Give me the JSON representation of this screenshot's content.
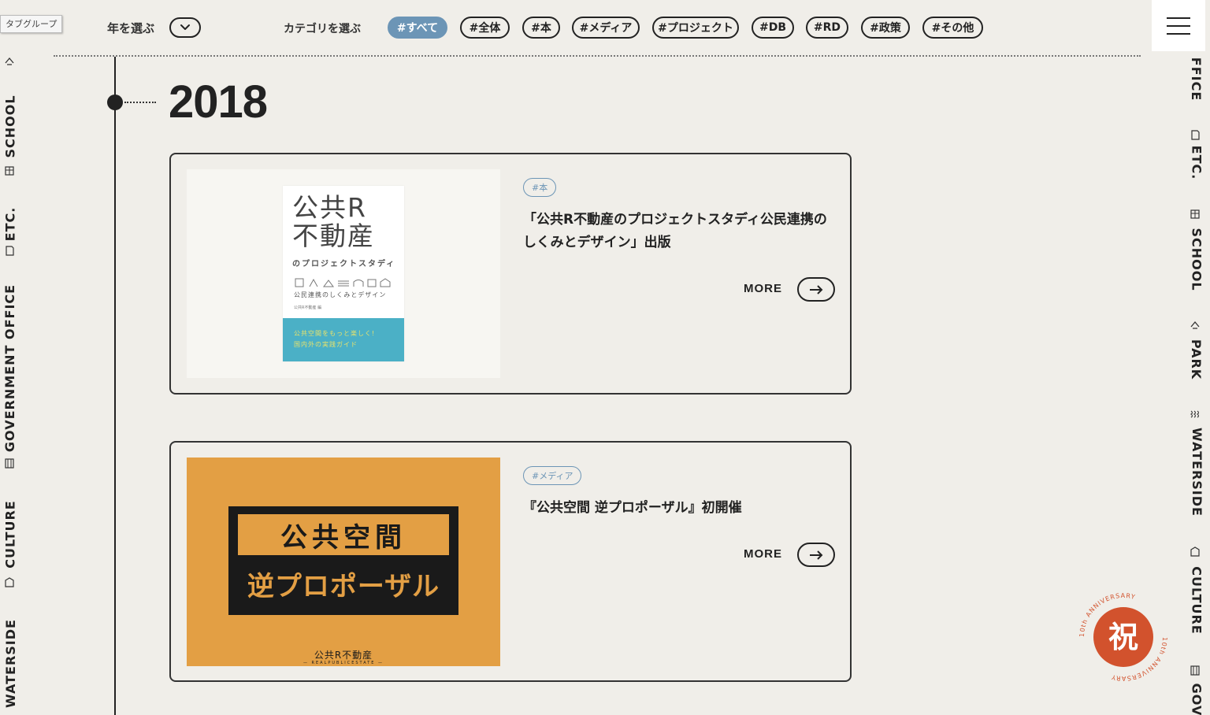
{
  "header": {
    "tag_group_label": "タブグループ",
    "year_select_label": "年を選ぶ",
    "category_select_label": "カテゴリを選ぶ",
    "categories": [
      {
        "label": "#すべて",
        "active": true
      },
      {
        "label": "#全体",
        "active": false
      },
      {
        "label": "#本",
        "active": false
      },
      {
        "label": "#メディア",
        "active": false
      },
      {
        "label": "#プロジェクト",
        "active": false
      },
      {
        "label": "#DB",
        "active": false
      },
      {
        "label": "#RD",
        "active": false
      },
      {
        "label": "#政策",
        "active": false
      },
      {
        "label": "#その他",
        "active": false
      }
    ],
    "menu_icon": "hamburger-icon"
  },
  "left_rail": {
    "labels": [
      "SCHOOL",
      "ETC.",
      "GOVERNMENT OFFICE",
      "CULTURE",
      "WATERSIDE"
    ]
  },
  "right_rail": {
    "labels": [
      "FFICE",
      "ETC.",
      "SCHOOL",
      "PARK",
      "WATERSIDE",
      "CULTURE",
      "GOV"
    ]
  },
  "timeline": {
    "year": "2018"
  },
  "cards": [
    {
      "tag": "#本",
      "title": "「公共R不動産のプロジェクトスタディ公民連携のしくみとデザイン」出版",
      "more_label": "MORE",
      "thumbnail": {
        "kind": "book-cover",
        "title_line1": "公共R",
        "title_line2": "不動産",
        "subtitle": "のプロジェクトスタディ",
        "subtitle2": "公民連携のしくみとデザイン",
        "editor": "公共R不動産 編",
        "band_line1": "公共空間をもっと楽しく!",
        "band_line2": "国内外の実践ガイド"
      }
    },
    {
      "tag": "#メディア",
      "title": "『公共空間 逆プロポーザル』初開催",
      "more_label": "MORE",
      "thumbnail": {
        "kind": "poster",
        "line1": "公共空間",
        "line2": "逆プロポーザル",
        "logo": "公共R不動産",
        "logo_sub": "— REALPUBLICESTATE —"
      }
    }
  ],
  "badge": {
    "center_char": "祝",
    "ring_text": "10th ANNIVERSARY",
    "color": "#d2522d"
  },
  "colors": {
    "background": "#f0eee9",
    "accent_blue": "#6c95b6",
    "book_band": "#4bb0c6",
    "poster_orange": "#e39f44"
  }
}
